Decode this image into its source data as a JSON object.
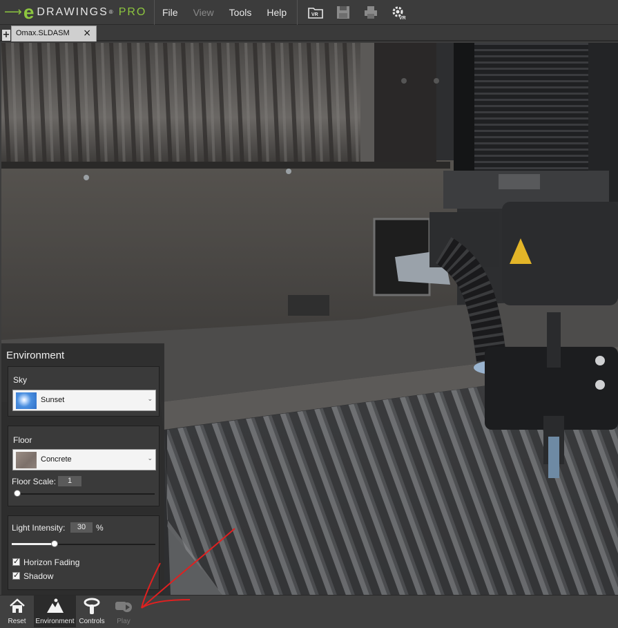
{
  "app": {
    "brand": "DRAWINGS",
    "edition": "PRO",
    "logo_letter": "e",
    "accent_color": "#8dc63f"
  },
  "menu": {
    "items": [
      {
        "label": "File",
        "enabled": true
      },
      {
        "label": "View",
        "enabled": false
      },
      {
        "label": "Tools",
        "enabled": true
      },
      {
        "label": "Help",
        "enabled": true
      }
    ]
  },
  "toolbar": {
    "icons": [
      "open-vr-icon",
      "save-icon",
      "print-icon",
      "vr-settings-icon"
    ],
    "vr_label": "VR",
    "vr_settings_label": "VR"
  },
  "tabs": {
    "add_symbol": "+",
    "open_file": "Omax.SLDASM",
    "close_symbol": "×"
  },
  "environment": {
    "title": "Environment",
    "sky": {
      "label": "Sky",
      "value": "Sunset",
      "thumb_color": "#4a8fe0"
    },
    "floor": {
      "label": "Floor",
      "value": "Concrete",
      "thumb_color": "#8a7c74",
      "scale_label": "Floor Scale:",
      "scale_value": "1",
      "scale_slider_fraction": 0.0
    },
    "light": {
      "label": "Light Intensity:",
      "value": "30",
      "unit": "%",
      "slider_fraction": 0.3
    },
    "horizon_fading": {
      "label": "Horizon Fading",
      "checked": true
    },
    "shadow": {
      "label": "Shadow",
      "checked": true
    }
  },
  "bottom_toolbar": {
    "buttons": [
      {
        "label": "Reset",
        "icon": "home-icon",
        "state": "normal"
      },
      {
        "label": "Environment",
        "icon": "mountain-icon",
        "state": "active"
      },
      {
        "label": "Controls",
        "icon": "vr-controller-icon",
        "state": "normal"
      },
      {
        "label": "Play",
        "icon": "play-icon",
        "state": "disabled"
      }
    ]
  },
  "annotation": {
    "color": "#e02020"
  }
}
